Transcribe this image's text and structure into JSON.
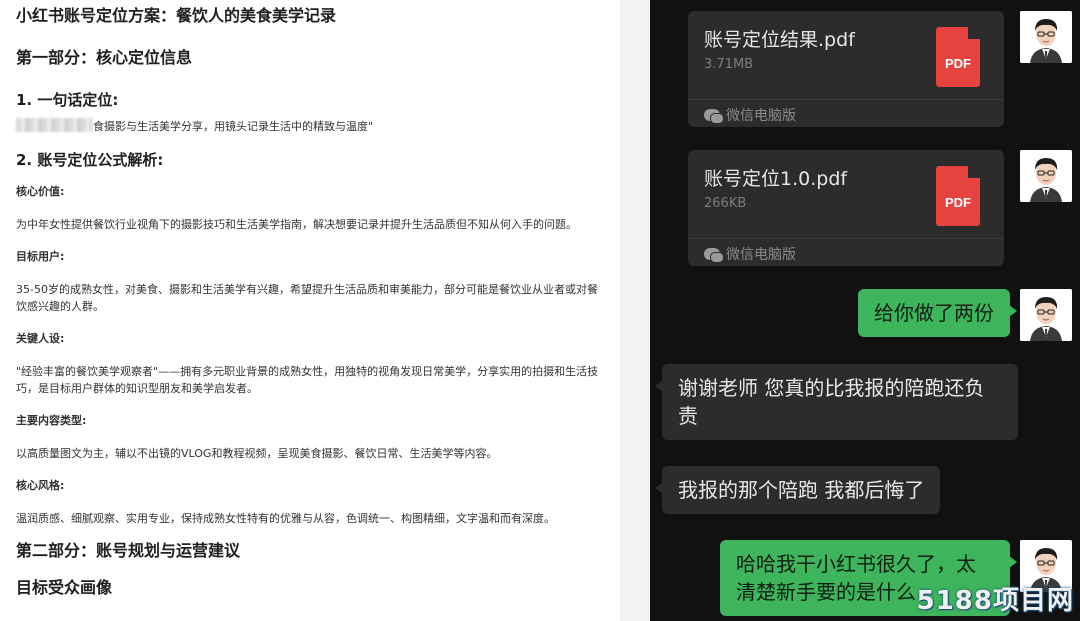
{
  "document": {
    "title": "小红书账号定位方案：餐饮人的美食美学记录",
    "section1": "第一部分：核心定位信息",
    "item1_heading": "1. 一句话定位:",
    "item1_text": "食摄影与生活美学分享，用镜头记录生活中的精致与温度\"",
    "item2_heading": "2. 账号定位公式解析:",
    "fields": [
      {
        "label": "核心价值:",
        "text": "为中年女性提供餐饮行业视角下的摄影技巧和生活美学指南，解决想要记录并提升生活品质但不知从何入手的问题。"
      },
      {
        "label": "目标用户:",
        "text": "35-50岁的成熟女性，对美食、摄影和生活美学有兴趣，希望提升生活品质和审美能力，部分可能是餐饮业从业者或对餐饮感兴趣的人群。"
      },
      {
        "label": "关键人设:",
        "text": "\"经验丰富的餐饮美学观察者\"——拥有多元职业背景的成熟女性，用独特的视角发现日常美学，分享实用的拍摄和生活技巧，是目标用户群体的知识型朋友和美学启发者。"
      },
      {
        "label": "主要内容类型:",
        "text": "以高质量图文为主，辅以不出镜的VLOG和教程视频，呈现美食摄影、餐饮日常、生活美学等内容。"
      },
      {
        "label": "核心风格:",
        "text": "温润质感、细腻观察、实用专业，保持成熟女性特有的优雅与从容，色调统一、构图精细，文字温和而有深度。"
      }
    ],
    "section2": "第二部分：账号规划与运营建议",
    "subsection": "目标受众画像"
  },
  "chat": {
    "files": [
      {
        "name": "账号定位结果.pdf",
        "size": "3.71MB",
        "badge": "PDF",
        "source": "微信电脑版"
      },
      {
        "name": "账号定位1.0.pdf",
        "size": "266KB",
        "badge": "PDF",
        "source": "微信电脑版"
      }
    ],
    "messages": [
      {
        "side": "out",
        "text": "给你做了两份"
      },
      {
        "side": "in",
        "text": "谢谢老师 您真的比我报的陪跑还负责"
      },
      {
        "side": "in",
        "text": "我报的那个陪跑 我都后悔了"
      },
      {
        "side": "out",
        "text": "哈哈我干小红书很久了，太清楚新手要的是什么"
      }
    ]
  },
  "watermark": "5188项目网",
  "colors": {
    "chat_bg": "#111111",
    "bubble_out": "#3eb55c",
    "bubble_in": "#2c2c2c",
    "pdf_red": "#e64340"
  }
}
